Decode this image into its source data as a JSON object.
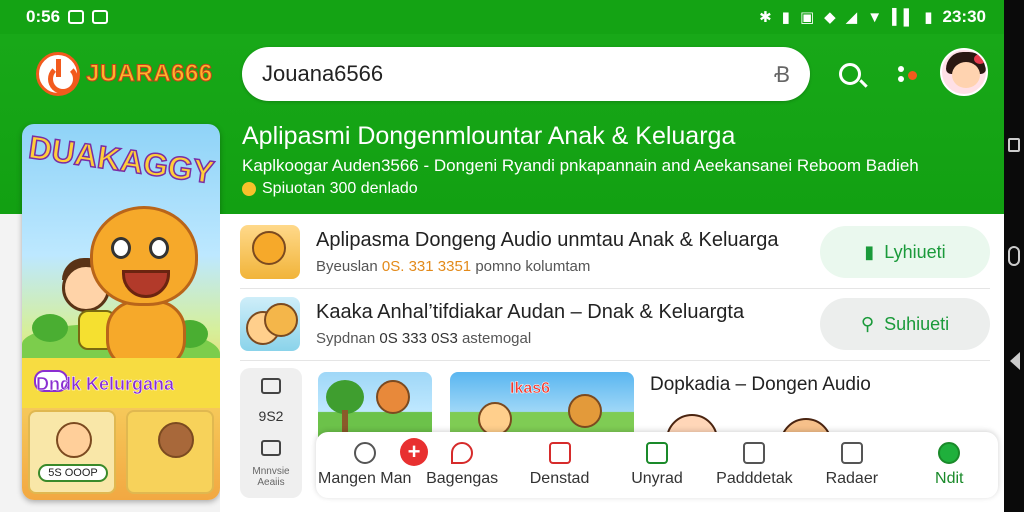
{
  "status_bar": {
    "time_left": "0:56",
    "time_right": "23:30"
  },
  "header": {
    "logo_text": "JUARA666",
    "search_value": "Jouana6566",
    "search_icon": "search-icon",
    "mic_icon": "mic-icon",
    "menu_icon": "dots-menu-icon"
  },
  "hero": {
    "title": "Aplipasmi Dongenmlountar Anak & Keluarga",
    "subtitle": "Kaplkoogar Auden3566 - Dongeni Ryandi pnkapannain and Aeekansanei Reboom Badieh",
    "meta": "Spiuotan 300 denlado"
  },
  "cover": {
    "title": "DUAKAGGY",
    "band_text": "Dndk Kelurgana",
    "badge_text": "ONS",
    "pill_text": "5S OOOP"
  },
  "list": {
    "items": [
      {
        "title": "Aplipasma Dongeng Audio unmtau Anak & Keluarga",
        "meta_prefix": "Byeuslan",
        "meta_num": "0S. 331 3351",
        "meta_suffix": "pomno kolumtam",
        "button_label": "Lyhiueti"
      },
      {
        "title": "Kaaka Anhal’tifdiakar Audan – Dnak & Keluargta",
        "meta_prefix": "Sypdnan",
        "meta_num": "0S 333 0S3",
        "meta_suffix": "astemogal",
        "button_label": "Suhiueti"
      }
    ],
    "side_panel": {
      "count": "9S2",
      "label": "Mnnvsie Aeaiis"
    },
    "tile_label": "Ikas6",
    "promo_title": "Dopkadia – Dongen Audio"
  },
  "bottom_nav": {
    "items": [
      {
        "label": "Mangen Man",
        "icon": "speedometer-icon"
      },
      {
        "label": "Bagengas",
        "icon": "pin-icon"
      },
      {
        "label": "Denstad",
        "icon": "book-icon"
      },
      {
        "label": "Unyrad",
        "icon": "calendar-icon"
      },
      {
        "label": "Padddetak",
        "icon": "card-icon"
      },
      {
        "label": "Radaer",
        "icon": "list-icon"
      },
      {
        "label": "Ndit",
        "icon": "shield-icon"
      }
    ],
    "badge": "+"
  },
  "colors": {
    "brand_green": "#14a314",
    "accent_orange": "#f25a1d",
    "button_green_text": "#1a9a3a",
    "badge_red": "#e83030"
  }
}
